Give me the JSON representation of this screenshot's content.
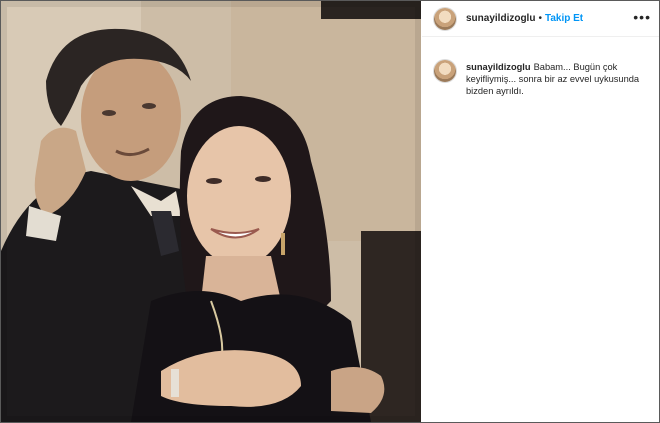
{
  "post": {
    "username": "sunayildizoglu",
    "separator": "•",
    "follow_label": "Takip Et",
    "more_icon": "more-options-icon",
    "caption": "Babam... Bugün çok keyifliymiş... sonra bir az evvel uykusunda bizden ayrıldı."
  },
  "colors": {
    "accent": "#0095f6",
    "text": "#262626",
    "border": "#efefef"
  }
}
